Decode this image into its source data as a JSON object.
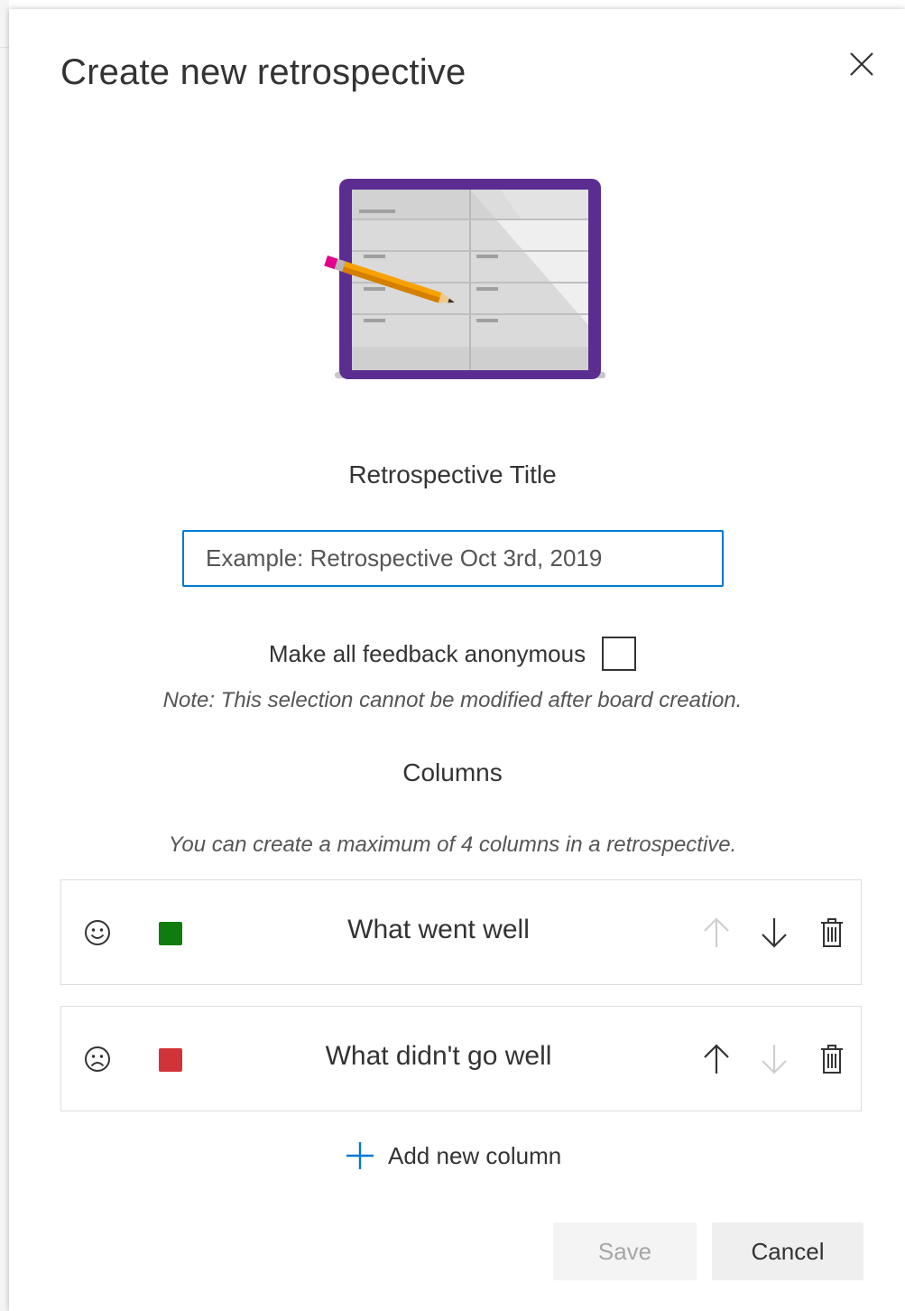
{
  "dialog": {
    "title": "Create new retrospective"
  },
  "form": {
    "title_label": "Retrospective Title",
    "title_placeholder": "Example: Retrospective Oct 3rd, 2019",
    "title_value": "",
    "anonymous_label": "Make all feedback anonymous",
    "anonymous_checked": false,
    "anonymous_note": "Note: This selection cannot be modified after board creation.",
    "columns_heading": "Columns",
    "columns_note": "You can create a maximum of 4 columns in a retrospective."
  },
  "columns": [
    {
      "name": "What went well",
      "icon": "smile-icon",
      "color": "#107c10",
      "can_move_up": false,
      "can_move_down": true
    },
    {
      "name": "What didn't go well",
      "icon": "frown-icon",
      "color": "#d13438",
      "can_move_up": true,
      "can_move_down": false
    }
  ],
  "actions": {
    "add_column_label": "Add new column",
    "save_label": "Save",
    "save_enabled": false,
    "cancel_label": "Cancel"
  },
  "colors": {
    "accent": "#0078d4",
    "hero_frame": "#5c2d91"
  }
}
